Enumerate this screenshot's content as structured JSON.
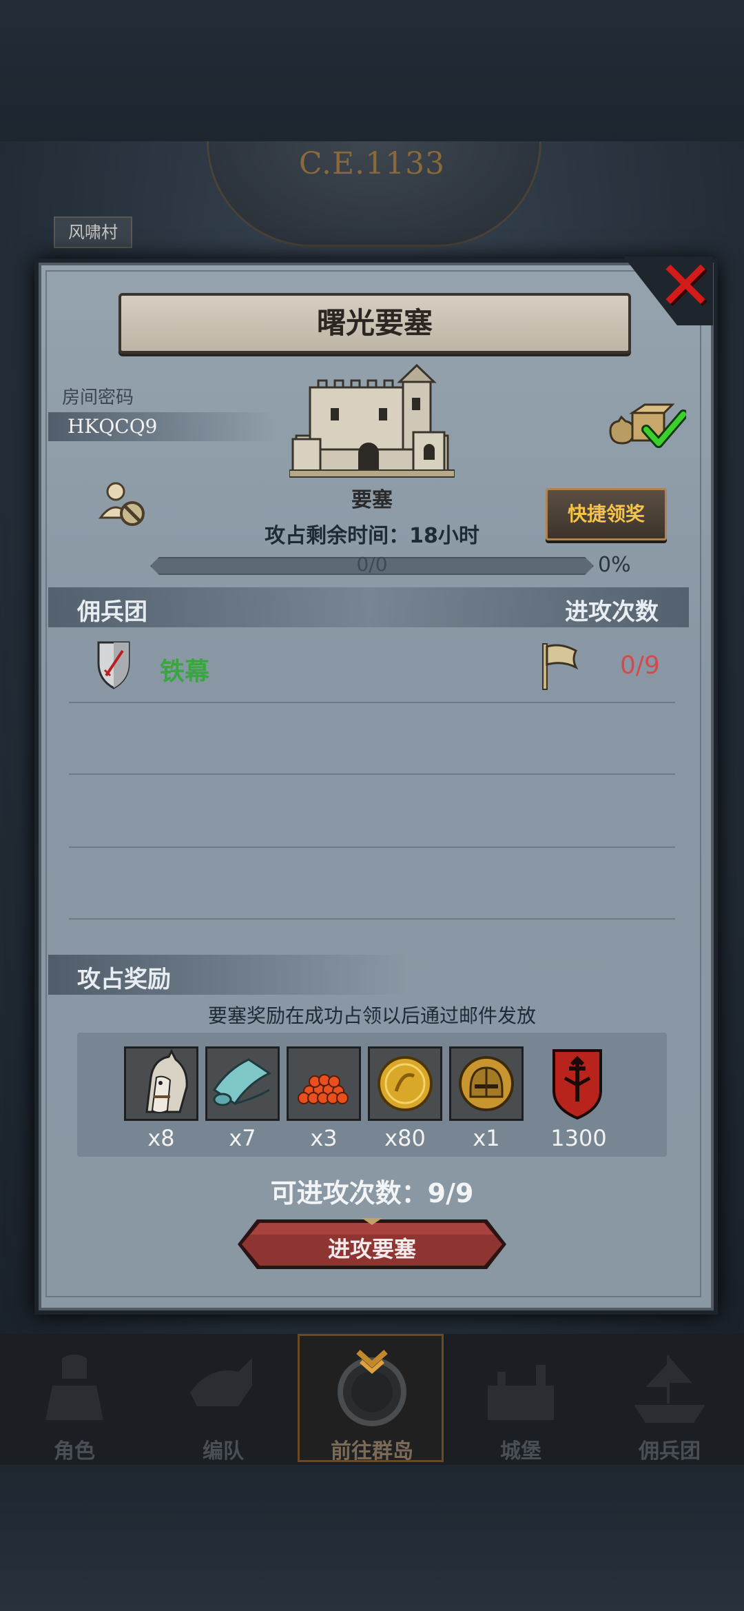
{
  "background": {
    "era": "C.E.1133",
    "village_label": "风啸村"
  },
  "modal": {
    "title": "曙光要塞",
    "close_icon": "close-x-icon",
    "room": {
      "label": "房间密码",
      "code": "HKQCQ9"
    },
    "fortress": {
      "name": "要塞",
      "icon": "castle-icon"
    },
    "occupation_time": {
      "label": "攻占剩余时间：",
      "value": "18小时"
    },
    "progress": {
      "count": "0/0",
      "percent": "0%",
      "fraction": 0
    },
    "quick_claim_label": "快捷领奖",
    "icons": {
      "hide_user": "user-hidden-icon",
      "claimed": "claimed-loot-icon"
    },
    "mercenary_header": "佣兵团",
    "attacks_header": "进攻次数",
    "mercenaries": [
      {
        "name": "铁幕",
        "attacks": "0/9",
        "icon": "shield-sword-icon",
        "flag_icon": "flag-icon"
      }
    ],
    "rewards": {
      "header": "攻占奖励",
      "note": "要塞奖励在成功占领以后通过邮件发放",
      "items": [
        {
          "icon": "horse-icon",
          "count": "x8"
        },
        {
          "icon": "cloth-roll-icon",
          "count": "x7"
        },
        {
          "icon": "fish-roe-icon",
          "count": "x3"
        },
        {
          "icon": "gold-coin-icon",
          "count": "x80"
        },
        {
          "icon": "knight-helmet-icon",
          "count": "x1"
        }
      ],
      "badge": {
        "icon": "guild-banner-icon",
        "count": "1300"
      }
    },
    "attempts": {
      "label": "可进攻次数：",
      "value": "9/9"
    },
    "attack_button_label": "进攻要塞"
  },
  "nav": [
    {
      "label": "角色",
      "icon": "knight-icon"
    },
    {
      "label": "编队",
      "icon": "cavalry-icon"
    },
    {
      "label": "前往群岛",
      "icon": "compass-icon",
      "active": true
    },
    {
      "label": "城堡",
      "icon": "castle-icon"
    },
    {
      "label": "佣兵团",
      "icon": "ship-icon"
    }
  ],
  "colors": {
    "accent_gold": "#f6c34a",
    "merc_green": "#3aa641",
    "attack_red": "#d44a4a",
    "close_red": "#d31b1b"
  }
}
